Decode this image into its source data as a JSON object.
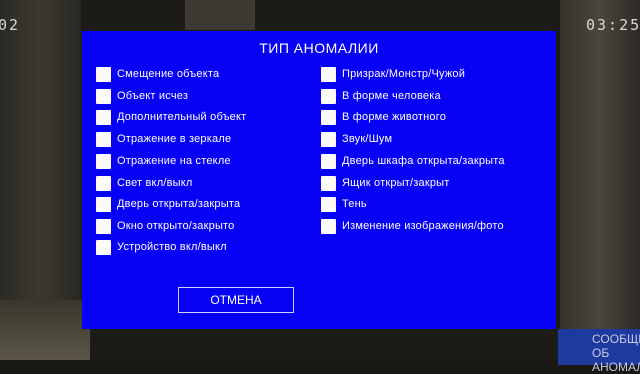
{
  "hud": {
    "left_counter": "02",
    "right_clock": "03:25"
  },
  "report_button": {
    "label": "СООБЩИТЬ ОБ АНОМАЛИИ"
  },
  "dialog": {
    "title": "ТИП АНОМАЛИИ",
    "left_options": [
      "Смещение объекта",
      "Объект исчез",
      "Дополнительный объект",
      "Отражение в зеркале",
      "Отражение на стекле",
      "Свет вкл/выкл",
      "Дверь открыта/закрыта",
      "Окно открыто/закрыто",
      "Устройство вкл/выкл"
    ],
    "right_options": [
      "Призрак/Монстр/Чужой",
      "В форме человека",
      "В форме животного",
      "Звук/Шум",
      "Дверь шкафа открыта/закрыта",
      "Ящик открыт/закрыт",
      "Тень",
      "Изменение изображения/фото"
    ],
    "cancel_label": "ОТМЕНА"
  }
}
